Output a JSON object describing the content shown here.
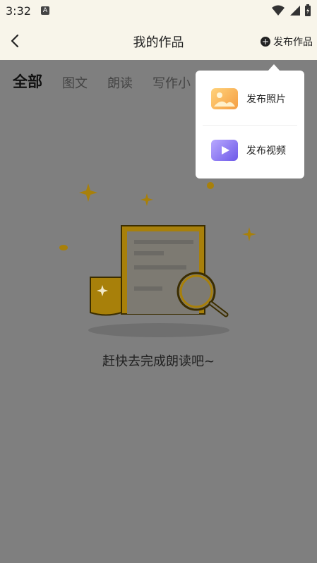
{
  "status": {
    "time": "3:32",
    "notif_letter": "A"
  },
  "header": {
    "title": "我的作品",
    "publish_label": "发布作品"
  },
  "tabs": [
    {
      "label": "全部",
      "active": true
    },
    {
      "label": "图文",
      "active": false
    },
    {
      "label": "朗读",
      "active": false
    },
    {
      "label": "写作小",
      "active": false
    }
  ],
  "empty": {
    "message": "赶快去完成朗读吧~"
  },
  "popup": {
    "items": [
      {
        "label": "发布照片",
        "icon": "photo-icon"
      },
      {
        "label": "发布视频",
        "icon": "video-icon"
      }
    ]
  },
  "colors": {
    "header_bg": "#f8f5ea",
    "overlay_gray": "#7f7f7f",
    "illustration_gold": "#a8800a"
  }
}
